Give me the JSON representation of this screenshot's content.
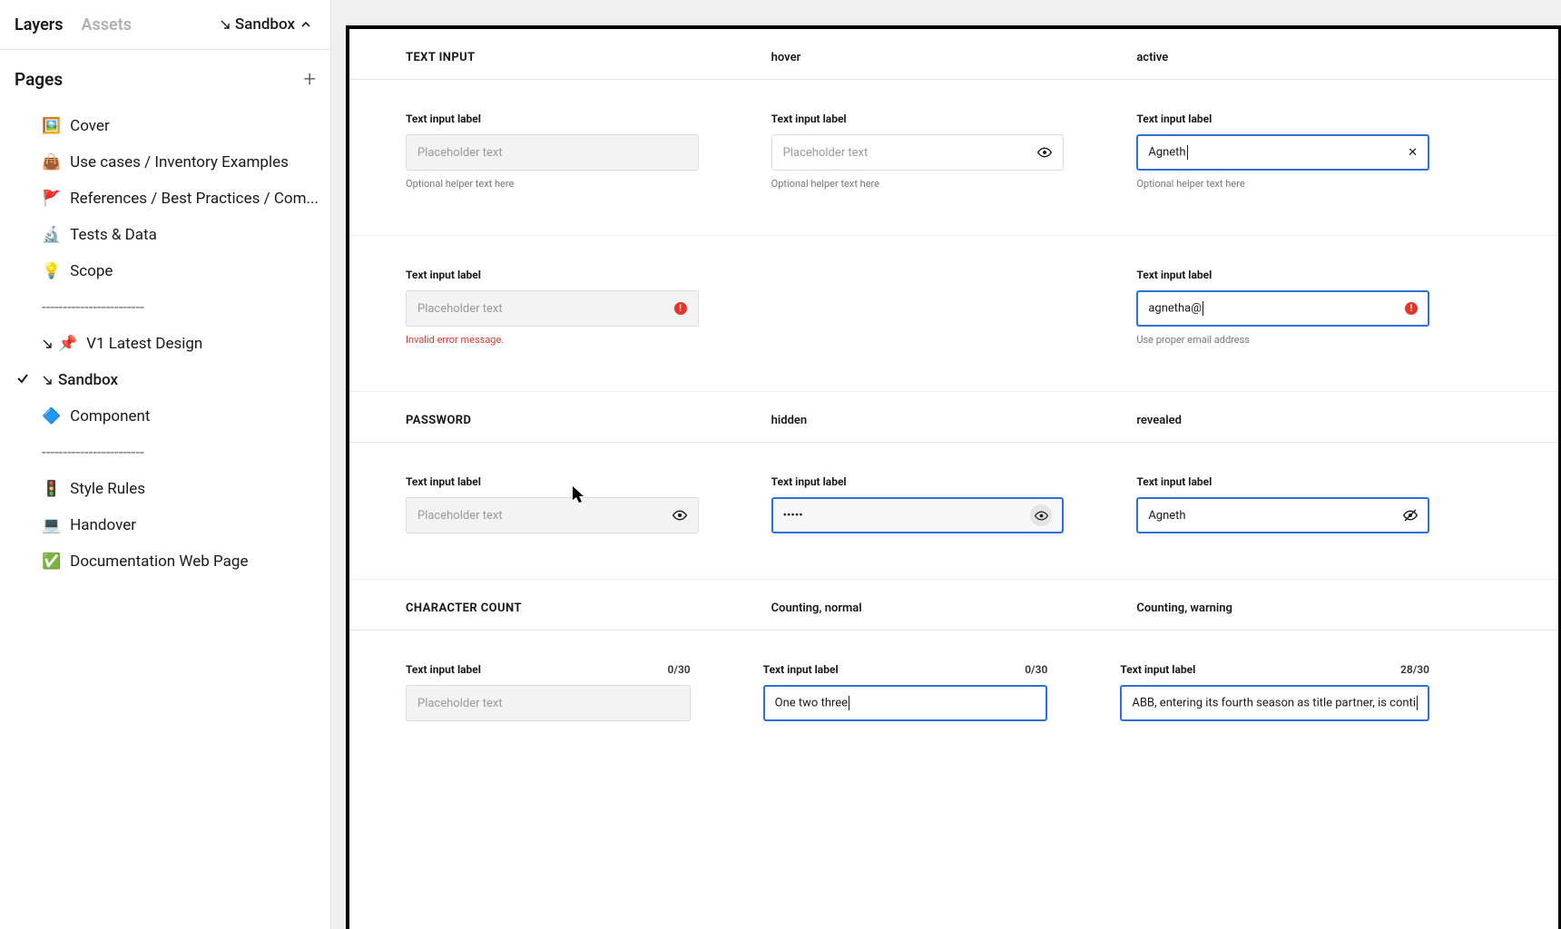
{
  "sidebar": {
    "tab_layers": "Layers",
    "tab_assets": "Assets",
    "dropdown_label": "Sandbox",
    "pages_title": "Pages",
    "items": [
      {
        "icon": "🖼️",
        "label": "Cover"
      },
      {
        "icon": "👜",
        "label": "Use cases / Inventory Examples"
      },
      {
        "icon": "🚩",
        "label": "References  / Best Practices / Com..."
      },
      {
        "icon": "🔬",
        "label": "Tests & Data"
      },
      {
        "icon": "💡",
        "label": "Scope"
      },
      {
        "divider": true,
        "label": "------------------------"
      },
      {
        "arrow": true,
        "icon": "📌",
        "label": "V1  Latest Design"
      },
      {
        "arrow": true,
        "icon": "",
        "label": "Sandbox",
        "selected": true
      },
      {
        "icon": "🔷",
        "label": "Component"
      },
      {
        "divider": true,
        "label": "------------------------"
      },
      {
        "icon": "🚦",
        "label": "Style Rules"
      },
      {
        "icon": "💻",
        "label": "Handover"
      },
      {
        "icon": "✅",
        "label": "Documentation Web Page"
      }
    ]
  },
  "sections": {
    "text_input": {
      "heading": "TEXT INPUT",
      "col2": "hover",
      "col3": "active",
      "row1": {
        "label": "Text input label",
        "placeholder": "Placeholder text",
        "helper": "Optional helper text here",
        "active_value": "Agneth"
      },
      "row2": {
        "label": "Text input label",
        "placeholder": "Placeholder text",
        "error_msg": "Invalid error message.",
        "active_value": "agnetha@",
        "active_helper": "Use proper email address"
      }
    },
    "password": {
      "heading": "PASSWORD",
      "col2": "hidden",
      "col3": "revealed",
      "row1": {
        "label": "Text input label",
        "placeholder": "Placeholder text",
        "hidden_value": "•••••",
        "revealed_value": "Agneth"
      }
    },
    "charcount": {
      "heading": "CHARACTER COUNT",
      "col2": "Counting, normal",
      "col3": "Counting, warning",
      "row1": {
        "label": "Text input label",
        "placeholder": "Placeholder text",
        "c1_counter": "0/30",
        "c2_counter": "0/30",
        "c2_value": "One two three",
        "c3_counter": "28/30",
        "c3_value": "ABB, entering its fourth season as title partner, is conti"
      }
    }
  }
}
